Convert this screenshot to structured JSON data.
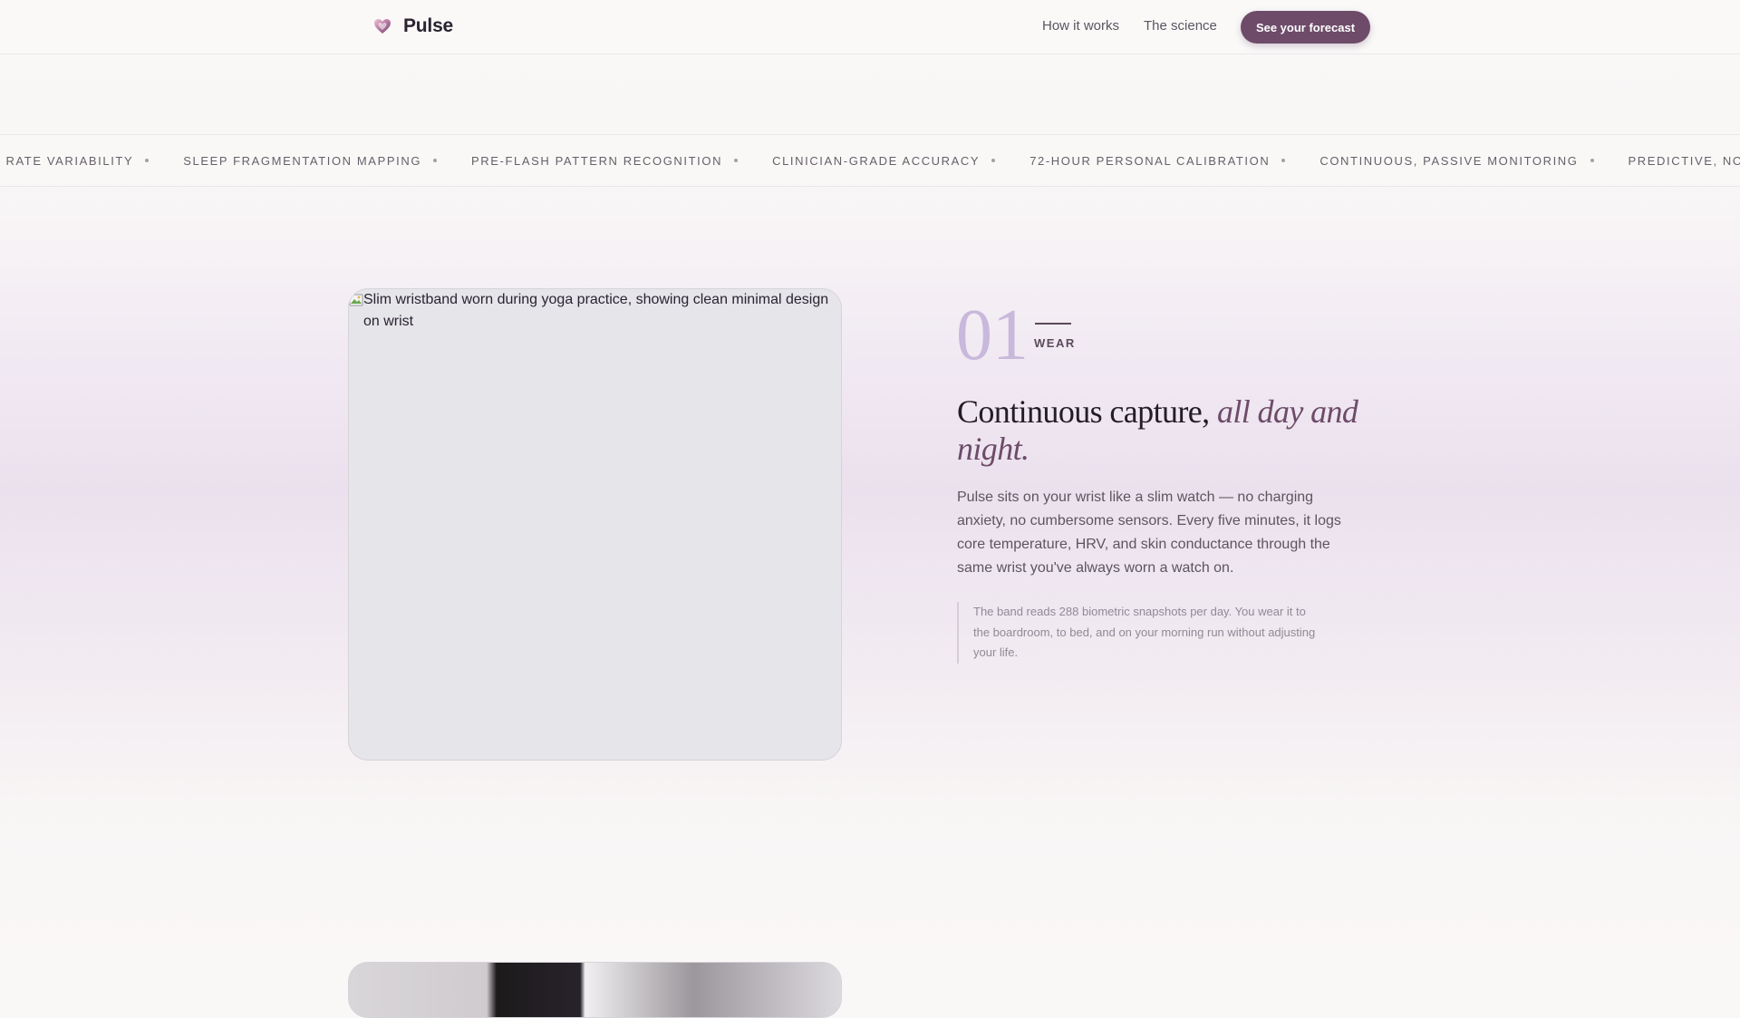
{
  "brand": {
    "name": "Pulse",
    "accent": "#6d4b69"
  },
  "nav": {
    "links": [
      "How it works",
      "The science"
    ],
    "cta_label": "See your forecast"
  },
  "ticker": {
    "items": [
      "T RATE VARIABILITY",
      "SLEEP FRAGMENTATION MAPPING",
      "PRE-FLASH PATTERN RECOGNITION",
      "CLINICIAN-GRADE ACCURACY",
      "72-HOUR PERSONAL CALIBRATION",
      "CONTINUOUS, PASSIVE MONITORING",
      "PREDICTIVE, NOT"
    ]
  },
  "step1": {
    "image_alt": "Slim wristband worn during yoga practice, showing clean minimal design on wrist",
    "number": "01",
    "label": "WEAR",
    "heading_plain": "Continuous capture, ",
    "heading_italic": "all day and night.",
    "body": "Pulse sits on your wrist like a slim watch — no charging anxiety, no cumbersome sensors. Every five minutes, it logs core temperature, HRV, and skin conductance through the same wrist you've always worn a watch on.",
    "quote": "The band reads 288 biometric snapshots per day. You wear it to the boardroom, to bed, and on your morning run without adjusting your life."
  }
}
